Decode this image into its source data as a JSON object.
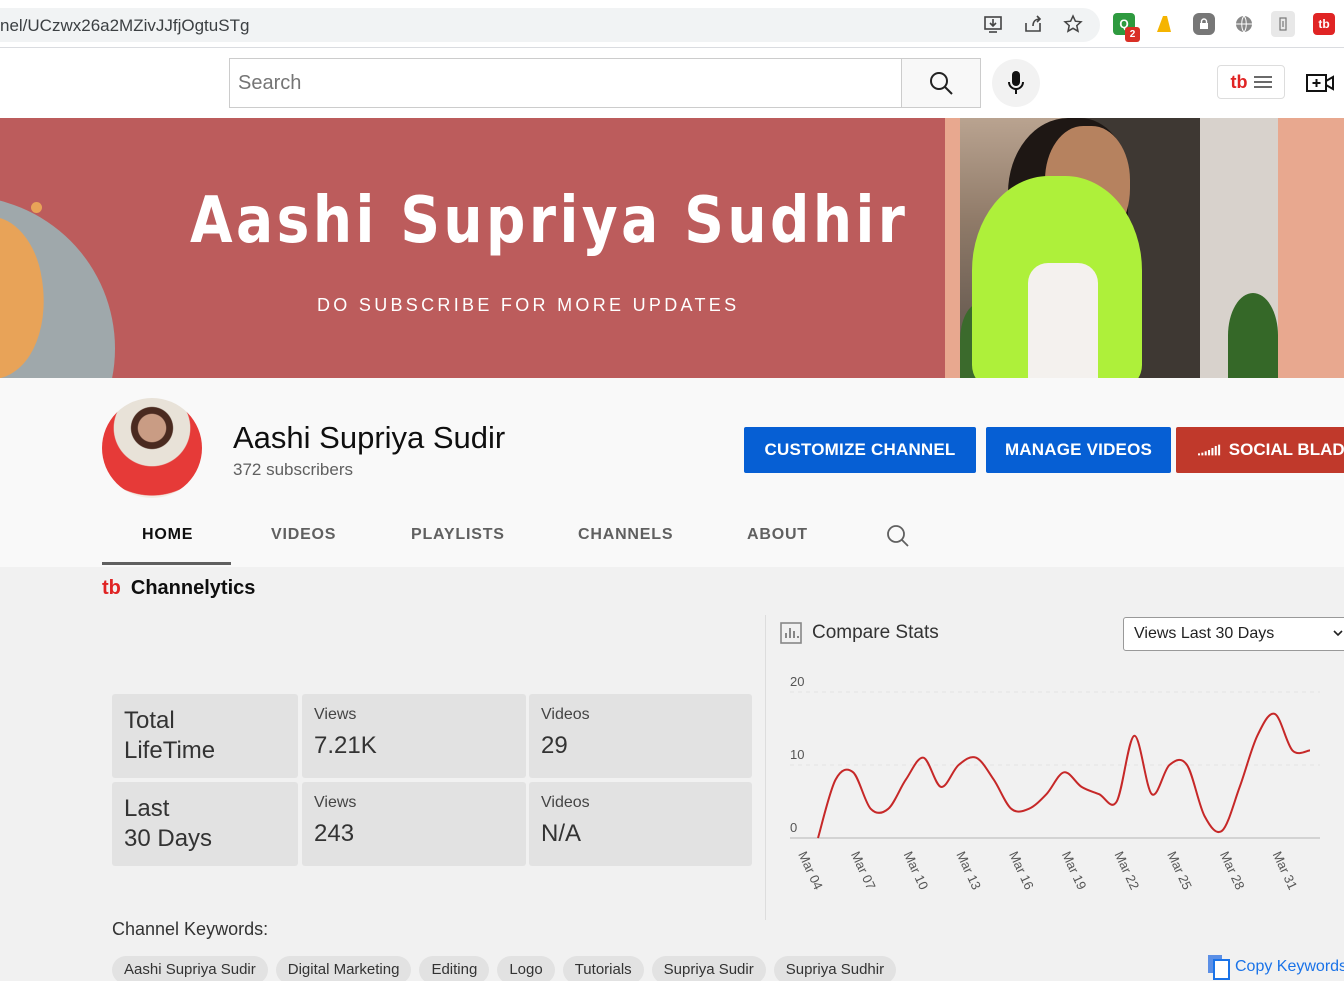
{
  "browser": {
    "url": "nel/UCzwx26a2MZivJJfjOgtuSTg",
    "ext_badge": "2"
  },
  "header": {
    "search_placeholder": "Search"
  },
  "banner": {
    "title": "Aashi Supriya Sudhir",
    "subtitle": "DO SUBSCRIBE FOR MORE UPDATES"
  },
  "channel": {
    "name": "Aashi Supriya Sudir",
    "subscribers": "372 subscribers",
    "buttons": {
      "customize": "CUSTOMIZE CHANNEL",
      "manage": "MANAGE VIDEOS",
      "social": "SOCIAL BLADE"
    },
    "tabs": [
      "HOME",
      "VIDEOS",
      "PLAYLISTS",
      "CHANNELS",
      "ABOUT"
    ]
  },
  "channelytics": {
    "title": "Channelytics",
    "rows": [
      {
        "label_line1": "Total",
        "label_line2": "LifeTime",
        "views_label": "Views",
        "views": "7.21K",
        "videos_label": "Videos",
        "videos": "29"
      },
      {
        "label_line1": "Last",
        "label_line2": "30 Days",
        "views_label": "Views",
        "views": "243",
        "videos_label": "Videos",
        "videos": "N/A"
      }
    ],
    "compare_title": "Compare Stats",
    "select_value": "Views Last 30 Days",
    "keywords_title": "Channel Keywords:",
    "keywords": [
      "Aashi Supriya Sudir",
      "Digital Marketing",
      "Editing",
      "Logo",
      "Tutorials",
      "Supriya Sudir",
      "Supriya Sudhir"
    ],
    "copy_keywords": "Copy Keywords"
  },
  "chart_data": {
    "type": "line",
    "title": "",
    "xlabel": "",
    "ylabel": "",
    "ylim": [
      0,
      20
    ],
    "yticks": [
      0,
      10,
      20
    ],
    "x_tick_labels": [
      "Mar 04",
      "Mar 07",
      "Mar 10",
      "Mar 13",
      "Mar 16",
      "Mar 19",
      "Mar 22",
      "Mar 25",
      "Mar 28",
      "Mar 31"
    ],
    "x": [
      "Mar 04",
      "Mar 05",
      "Mar 06",
      "Mar 07",
      "Mar 08",
      "Mar 09",
      "Mar 10",
      "Mar 11",
      "Mar 12",
      "Mar 13",
      "Mar 14",
      "Mar 15",
      "Mar 16",
      "Mar 17",
      "Mar 18",
      "Mar 19",
      "Mar 20",
      "Mar 21",
      "Mar 22",
      "Mar 23",
      "Mar 24",
      "Mar 25",
      "Mar 26",
      "Mar 27",
      "Mar 28",
      "Mar 29",
      "Mar 30",
      "Mar 31",
      "Apr 01"
    ],
    "series": [
      {
        "values": [
          0,
          8,
          9,
          4,
          4,
          8,
          11,
          7,
          10,
          11,
          8,
          4,
          4,
          6,
          9,
          7,
          6,
          5,
          14,
          6,
          10,
          10,
          3,
          1,
          7,
          14,
          17,
          12,
          12
        ],
        "color": "#c62828"
      }
    ],
    "grid": true,
    "line_color": "#c62828"
  }
}
